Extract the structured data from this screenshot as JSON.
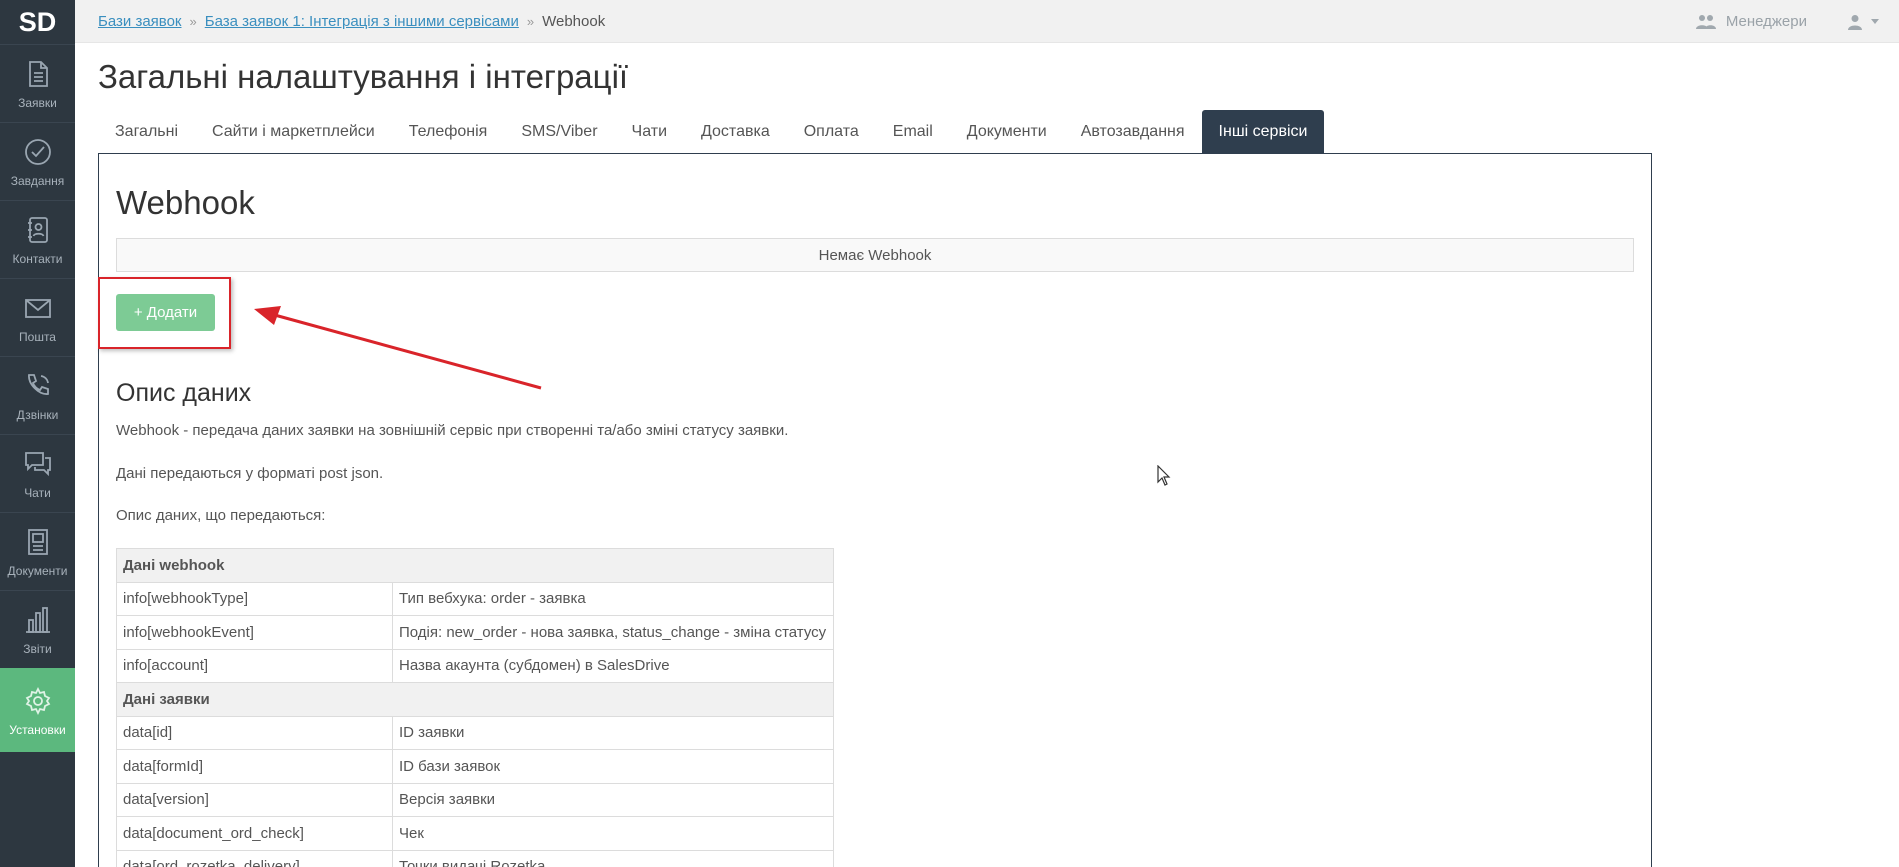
{
  "sidebar": {
    "logo": "SD",
    "items": [
      {
        "label": "Заявки",
        "icon": "document-icon"
      },
      {
        "label": "Завдання",
        "icon": "check-circle-icon"
      },
      {
        "label": "Контакти",
        "icon": "contacts-book-icon"
      },
      {
        "label": "Пошта",
        "icon": "envelope-icon"
      },
      {
        "label": "Дзвінки",
        "icon": "phone-icon"
      },
      {
        "label": "Чати",
        "icon": "chat-bubbles-icon"
      },
      {
        "label": "Документи",
        "icon": "documents-icon"
      },
      {
        "label": "Звіти",
        "icon": "bar-chart-icon"
      },
      {
        "label": "Установки",
        "icon": "gear-icon",
        "active": true
      }
    ]
  },
  "breadcrumb": {
    "link1": "Бази заявок",
    "link2": "База заявок 1: Інтеграція з іншими сервісами",
    "current": "Webhook",
    "separator": "»"
  },
  "topbar": {
    "managers_label": "Менеджери"
  },
  "page": {
    "title": "Загальні налаштування і інтеграції"
  },
  "tabs": [
    {
      "label": "Загальні"
    },
    {
      "label": "Сайти і маркетплейси"
    },
    {
      "label": "Телефонія"
    },
    {
      "label": "SMS/Viber"
    },
    {
      "label": "Чати"
    },
    {
      "label": "Доставка"
    },
    {
      "label": "Оплата"
    },
    {
      "label": "Email"
    },
    {
      "label": "Документи"
    },
    {
      "label": "Автозавдання"
    },
    {
      "label": "Інші сервіси",
      "active": true
    }
  ],
  "webhook": {
    "title": "Webhook",
    "empty_text": "Немає Webhook",
    "add_button": "+ Додати"
  },
  "description": {
    "title": "Опис даних",
    "p1": "Webhook - передача даних заявки на зовнішній сервіс при створенні та/або зміні статусу заявки.",
    "p2": "Дані передаються у форматі post json.",
    "p3": "Опис даних, що передаються:"
  },
  "table": {
    "groups": [
      {
        "title": "Дані webhook",
        "rows": [
          [
            "info[webhookType]",
            "Тип вебхука: order - заявка"
          ],
          [
            "info[webhookEvent]",
            "Подія: new_order - нова заявка, status_change - зміна статусу"
          ],
          [
            "info[account]",
            "Назва акаунта (субдомен) в SalesDrive"
          ]
        ]
      },
      {
        "title": "Дані заявки",
        "rows": [
          [
            "data[id]",
            "ID заявки"
          ],
          [
            "data[formId]",
            "ID бази заявок"
          ],
          [
            "data[version]",
            "Версія заявки"
          ],
          [
            "data[document_ord_check]",
            "Чек"
          ],
          [
            "data[ord_rozetka_delivery]",
            "Точки видачі Rozetka"
          ]
        ]
      }
    ]
  },
  "colors": {
    "sidebar_bg": "#2d3740",
    "active_green": "#5cb87e",
    "add_button": "#7dcb95",
    "tab_active": "#2f3e4e",
    "highlight_red": "#d9242a"
  }
}
